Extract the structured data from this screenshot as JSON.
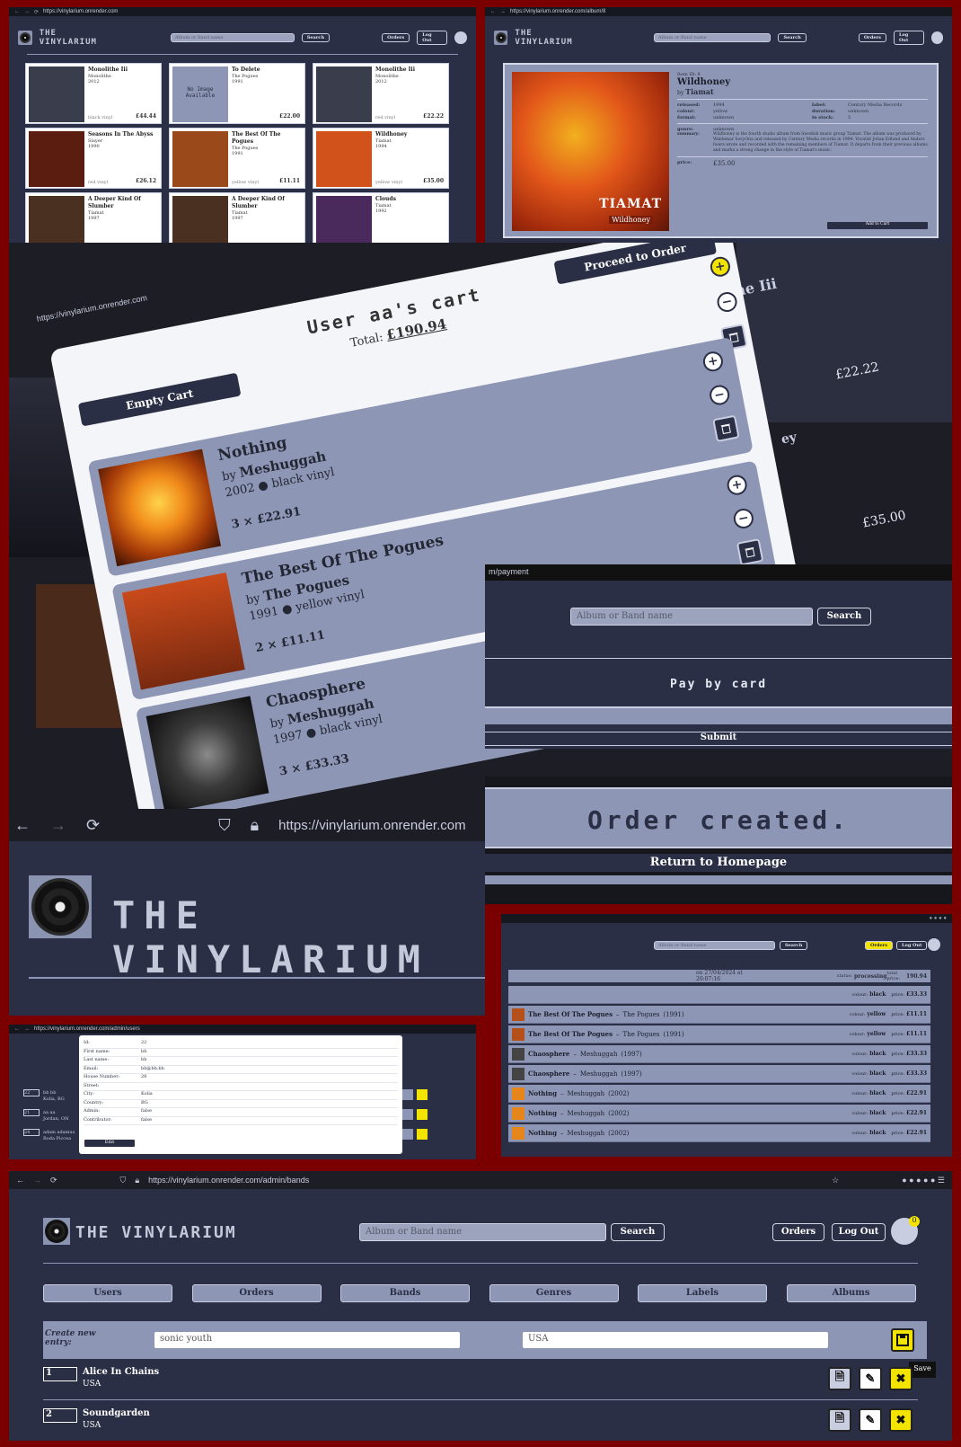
{
  "browser": {
    "url_grid": "https://vinylarium.onrender.com",
    "url_album": "https://vinylarium.onrender.com/album/8",
    "url_cart": "https://vinylarium.onrender.com",
    "url_payment_suffix": "m/payment",
    "url_big": "https://vinylarium.onrender.com",
    "url_users": "https://vinylarium.onrender.com/admin/users",
    "url_bands": "https://vinylarium.onrender.com/admin/bands"
  },
  "brand": {
    "name": "THE VINYLARIUM"
  },
  "header": {
    "search_placeholder": "Album or Band name",
    "search_button": "Search",
    "orders_button": "Orders",
    "logout_button": "Log Out",
    "cart_count": "0"
  },
  "grid": {
    "cards": [
      {
        "title": "Monolithe Iii",
        "band": "Monolithe",
        "year": "2012",
        "format": "black vinyl",
        "price": "£44.44"
      },
      {
        "title": "To Delete",
        "band": "The Pogues",
        "year": "1991",
        "format": "",
        "price": "£22.00",
        "placeholder": "No Image Available"
      },
      {
        "title": "Monolithe Iii",
        "band": "Monolithe",
        "year": "2012",
        "format": "red vinyl",
        "price": "£22.22"
      },
      {
        "title": "Seasons In The Abyss",
        "band": "Slayer",
        "year": "1990",
        "format": "red vinyl",
        "price": "£26.12"
      },
      {
        "title": "The Best Of The Pogues",
        "band": "The Pogues",
        "year": "1991",
        "format": "yellow vinyl",
        "price": "£11.11"
      },
      {
        "title": "Wildhoney",
        "band": "Tiamat",
        "year": "1994",
        "format": "yellow vinyl",
        "price": "£35.00"
      },
      {
        "title": "A Deeper Kind Of Slumber",
        "band": "Tiamat",
        "year": "1997",
        "format": "",
        "price": ""
      },
      {
        "title": "A Deeper Kind Of Slumber",
        "band": "Tiamat",
        "year": "1997",
        "format": "",
        "price": ""
      },
      {
        "title": "Clouds",
        "band": "Tiamat",
        "year": "1992",
        "format": "",
        "price": ""
      }
    ]
  },
  "album": {
    "id_label": "Item ID: 8",
    "title": "Wildhoney",
    "by": "by",
    "band": "Tiamat",
    "cover_text": "TIAMAT",
    "cover_sub": "Wildhoney",
    "fields": [
      {
        "k": "released:",
        "v": "1994"
      },
      {
        "k": "colour:",
        "v": "yellow"
      },
      {
        "k": "format:",
        "v": "unknown"
      },
      {
        "k": "label:",
        "v": "Century Media Records"
      },
      {
        "k": "duration:",
        "v": "unknown"
      },
      {
        "k": "in stock:",
        "v": "5"
      }
    ],
    "genre_label": "genre:",
    "genre_value": "unknown",
    "summary_label": "summary:",
    "summary": "Wildhoney is the fourth studio album from Swedish music group Tiamat. The album was produced by Waldemar Sorychta and released by Century Media records in 1994. Vocalist Johan Edlund and Anders Iwers wrote and recorded with the remaining members of Tiamat. It departs from their previous albums and marks a strong change in the style of Tiamat's music.",
    "price_label": "price:",
    "price": "£35.00",
    "add_button": "Add to Cart"
  },
  "cart": {
    "title": "User aa's cart",
    "total_label": "Total:",
    "total": "£190.94",
    "empty_button": "Empty Cart",
    "proceed_button": "Proceed to Order",
    "items": [
      {
        "title": "Nothing",
        "by": "by",
        "band": "Meshuggah",
        "year": "2002",
        "color": "black vinyl",
        "qty": "3 × £22.91"
      },
      {
        "title": "The Best Of The Pogues",
        "by": "by",
        "band": "The Pogues",
        "year": "1991",
        "color": "yellow vinyl",
        "qty": "2 × £11.11"
      },
      {
        "title": "Chaosphere",
        "by": "by",
        "band": "Meshuggah",
        "year": "1997",
        "color": "black vinyl",
        "qty": "3 × £33.33"
      }
    ],
    "bg_price_1": "£22.22",
    "bg_price_2": "£35.00",
    "bg_title_1": "he Iii",
    "bg_title_2": "ey"
  },
  "payment": {
    "heading": "Pay by card",
    "submit": "Submit"
  },
  "order_created": {
    "message": "Order created.",
    "return": "Return to Homepage"
  },
  "orders": {
    "header": {
      "date": "on 27/04/2024 at 20:07:16",
      "status_label": "status:",
      "status": "processing",
      "total_label": "total price:",
      "total": "190.94"
    },
    "rows": [
      {
        "title": "",
        "band": "",
        "year": "",
        "color": "black",
        "price": "£33.33"
      },
      {
        "title": "The Best Of The Pogues",
        "band": "The Pogues",
        "year": "(1991)",
        "color": "yellow",
        "price": "£11.11"
      },
      {
        "title": "The Best Of The Pogues",
        "band": "The Pogues",
        "year": "(1991)",
        "color": "yellow",
        "price": "£11.11"
      },
      {
        "title": "Chaosphere",
        "band": "Meshuggah",
        "year": "(1997)",
        "color": "black",
        "price": "£33.33"
      },
      {
        "title": "Chaosphere",
        "band": "Meshuggah",
        "year": "(1997)",
        "color": "black",
        "price": "£33.33"
      },
      {
        "title": "Nothing",
        "band": "Meshuggah",
        "year": "(2002)",
        "color": "black",
        "price": "£22.91"
      },
      {
        "title": "Nothing",
        "band": "Meshuggah",
        "year": "(2002)",
        "color": "black",
        "price": "£22.91"
      },
      {
        "title": "Nothing",
        "band": "Meshuggah",
        "year": "(2002)",
        "color": "black",
        "price": "£22.91"
      }
    ],
    "colour_label": "colour:",
    "price_label": "price:"
  },
  "user_modal": {
    "fields": [
      {
        "k": "Id:",
        "v": "22"
      },
      {
        "k": "First name:",
        "v": "bb"
      },
      {
        "k": "Last name:",
        "v": "bb"
      },
      {
        "k": "Email:",
        "v": "bb@bb.bb"
      },
      {
        "k": "House Number:",
        "v": "28"
      },
      {
        "k": "Street:",
        "v": ""
      },
      {
        "k": "City:",
        "v": "Kolia"
      },
      {
        "k": "Country:",
        "v": "BG"
      },
      {
        "k": "Admin:",
        "v": "false"
      },
      {
        "k": "Contributor:",
        "v": "false"
      }
    ],
    "edit": "Edit",
    "bg_rows": [
      {
        "id": "22",
        "name": "bb bb",
        "city": "Kolia, BG"
      },
      {
        "id": "21",
        "name": "aa aa",
        "city": "Jordan, ON"
      },
      {
        "id": "24",
        "name": "adam adamus",
        "city": "Roda Piccea"
      }
    ]
  },
  "admin": {
    "tabs": [
      "Users",
      "Orders",
      "Bands",
      "Genres",
      "Labels",
      "Albums"
    ],
    "create_label": "Create new entry:",
    "create_name": "sonic youth",
    "create_country": "USA",
    "save_tooltip": "Save",
    "bands": [
      {
        "id": "1",
        "name": "Alice In Chains",
        "country": "USA"
      },
      {
        "id": "2",
        "name": "Soundgarden",
        "country": "USA"
      }
    ]
  }
}
